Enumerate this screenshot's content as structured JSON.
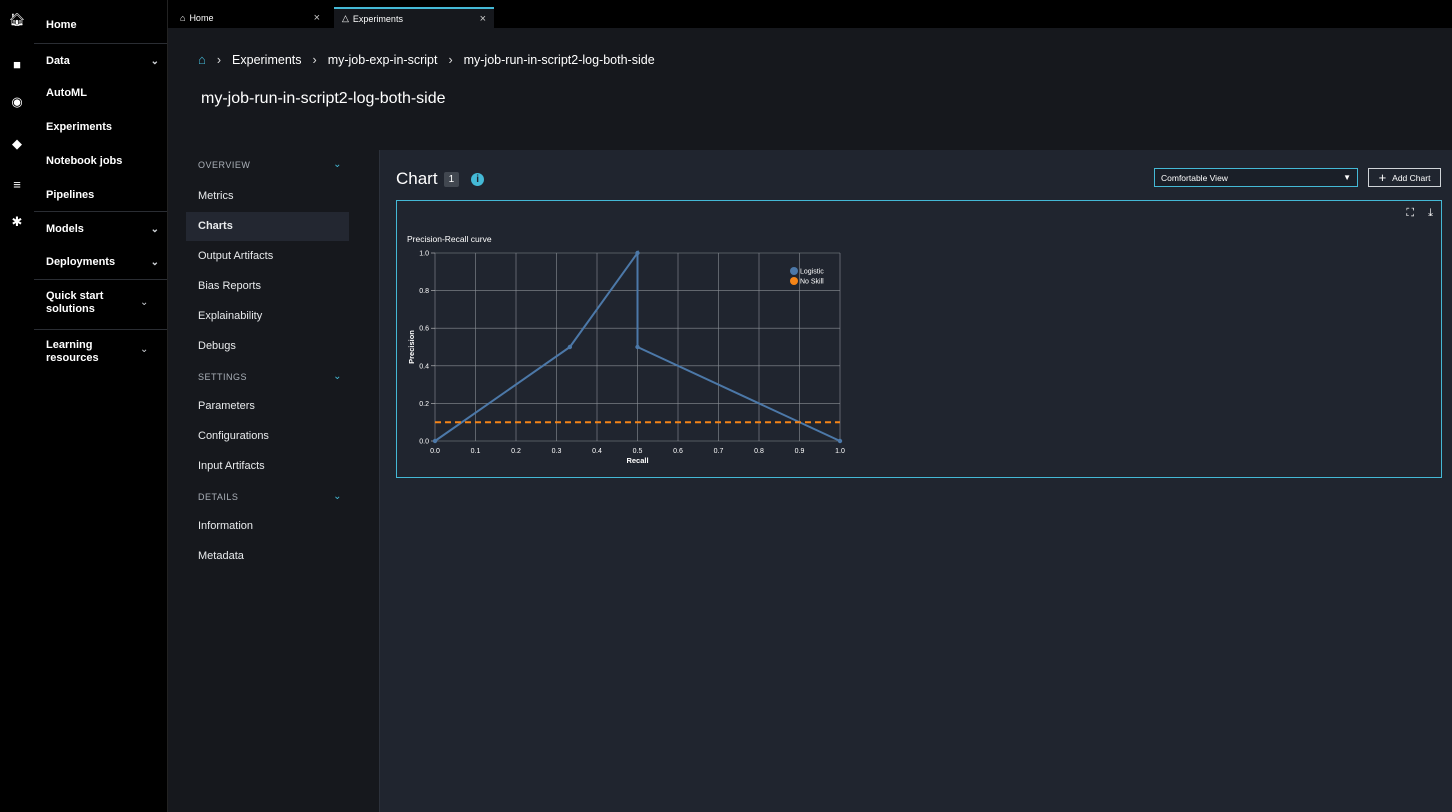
{
  "tabs": {
    "home": {
      "label": "Home",
      "icon": "home-icon",
      "close": "×"
    },
    "experiments": {
      "label": "Experiments",
      "icon": "flask-icon",
      "close": "×"
    }
  },
  "sidebar": {
    "items": [
      {
        "label": "Home",
        "chevron": false
      },
      {
        "label": "Data",
        "chevron": true
      },
      {
        "label": "AutoML",
        "chevron": false
      },
      {
        "label": "Experiments",
        "chevron": false
      },
      {
        "label": "Notebook jobs",
        "chevron": false
      },
      {
        "label": "Pipelines",
        "chevron": false
      },
      {
        "label": "Models",
        "chevron": true
      },
      {
        "label": "Deployments",
        "chevron": true
      },
      {
        "label": "Quick start solutions",
        "chevron": true
      },
      {
        "label": "Learning resources",
        "chevron": true
      }
    ]
  },
  "breadcrumb": [
    "Experiments",
    "my-job-exp-in-script",
    "my-job-run-in-script2-log-both-side"
  ],
  "page_title": "my-job-run-in-script2-log-both-side",
  "subnav": {
    "sections": [
      {
        "label": "OVERVIEW",
        "items": [
          "Metrics",
          "Charts",
          "Output Artifacts",
          "Bias Reports",
          "Explainability",
          "Debugs"
        ]
      },
      {
        "label": "SETTINGS",
        "items": [
          "Parameters",
          "Configurations",
          "Input Artifacts"
        ]
      },
      {
        "label": "DETAILS",
        "items": [
          "Information",
          "Metadata"
        ]
      }
    ],
    "active": "Charts"
  },
  "chart_panel": {
    "heading": "Chart",
    "count": "1",
    "view_select": "Comfortable View",
    "add_chart": "Add Chart"
  },
  "chart_data": {
    "type": "line",
    "title": "Precision-Recall curve",
    "xlabel": "Recall",
    "ylabel": "Precision",
    "xlim": [
      0,
      1
    ],
    "ylim": [
      0,
      1
    ],
    "xticks": [
      "0.0",
      "0.1",
      "0.2",
      "0.3",
      "0.4",
      "0.5",
      "0.6",
      "0.7",
      "0.8",
      "0.9",
      "1.0"
    ],
    "yticks": [
      "0.0",
      "0.2",
      "0.4",
      "0.6",
      "0.8",
      "1.0"
    ],
    "grid": true,
    "legend_position": "top-right",
    "series": [
      {
        "name": "Logistic",
        "color": "#4c78a8",
        "style": "solid",
        "x": [
          0.0,
          0.333,
          0.5,
          0.5,
          1.0
        ],
        "y": [
          0.0,
          0.5,
          1.0,
          0.5,
          0.0
        ]
      },
      {
        "name": "No Skill",
        "color": "#f58518",
        "style": "dashed",
        "x": [
          0.0,
          1.0
        ],
        "y": [
          0.1,
          0.1
        ]
      }
    ]
  }
}
